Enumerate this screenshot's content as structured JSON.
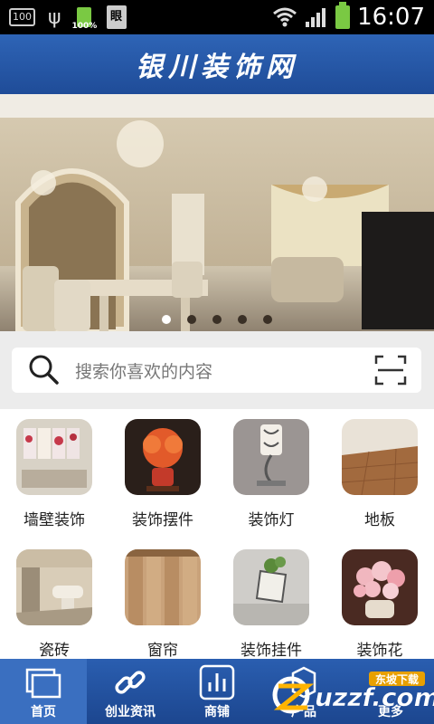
{
  "status_bar": {
    "left_box": "100",
    "battery_small_label": "100%",
    "doc_glyph": "眼",
    "time": "16:07"
  },
  "header": {
    "title": "银川装饰网"
  },
  "banner": {
    "slide_count": 5,
    "active_index": 0
  },
  "search": {
    "placeholder": "搜索你喜欢的内容"
  },
  "categories": [
    {
      "label": "墙壁装饰"
    },
    {
      "label": "装饰摆件"
    },
    {
      "label": "装饰灯"
    },
    {
      "label": "地板"
    },
    {
      "label": "瓷砖"
    },
    {
      "label": "窗帘"
    },
    {
      "label": "装饰挂件"
    },
    {
      "label": "装饰花"
    }
  ],
  "nav": [
    {
      "label": "首页",
      "active": true
    },
    {
      "label": "创业资讯",
      "active": false
    },
    {
      "label": "商铺",
      "active": false
    },
    {
      "label": "产品",
      "active": false
    },
    {
      "label": "更多",
      "active": false
    }
  ],
  "watermark": {
    "brand": "uzzf.com",
    "badge": "东坡下载"
  }
}
